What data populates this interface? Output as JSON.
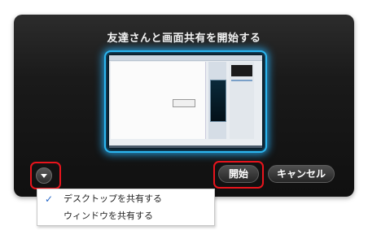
{
  "dialog": {
    "title": "友達さんと画面共有を開始する"
  },
  "buttons": {
    "start_label": "開始",
    "cancel_label": "キャンセル",
    "options_icon": "chevron-down-icon"
  },
  "menu": {
    "items": [
      {
        "label": "デスクトップを共有する",
        "checked": true
      },
      {
        "label": "ウィンドウを共有する",
        "checked": false
      }
    ]
  },
  "colors": {
    "highlight": "#e8141c",
    "preview_glow": "#2bb6f0",
    "checkmark": "#2868c8"
  }
}
